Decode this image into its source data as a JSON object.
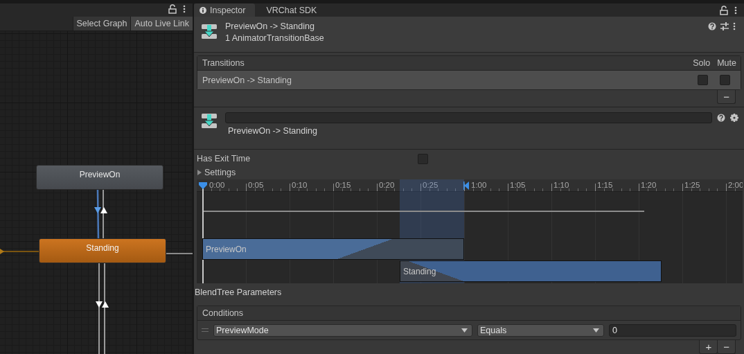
{
  "graph_panel": {
    "toolbar_buttons": [
      "Select Graph",
      "Auto Live Link"
    ],
    "nodes": [
      {
        "label": "PreviewOn",
        "kind": "state"
      },
      {
        "label": "Standing",
        "kind": "default"
      }
    ]
  },
  "inspector": {
    "tabs": [
      {
        "label": "Inspector",
        "selected": true
      },
      {
        "label": "VRChat SDK",
        "selected": false
      }
    ],
    "header": {
      "title": "PreviewOn -> Standing",
      "subtitle": "1 AnimatorTransitionBase"
    },
    "transitions": {
      "title": "Transitions",
      "columns": [
        "Solo",
        "Mute"
      ],
      "rows": [
        {
          "name": "PreviewOn -> Standing",
          "selected": true,
          "solo": false,
          "mute": false
        }
      ],
      "remove_button": "−"
    },
    "transition": {
      "label": "PreviewOn -> Standing"
    },
    "has_exit_time": {
      "label": "Has Exit Time",
      "checked": false
    },
    "settings": {
      "label": "Settings",
      "expanded": false
    },
    "timeline": {
      "ticks": [
        "0:00",
        "0:05",
        "0:10",
        "0:15",
        "0:20",
        "0:25",
        "1:00",
        "1:05",
        "1:10",
        "1:15",
        "1:20",
        "1:25",
        "2:00"
      ],
      "clips": [
        {
          "label": "PreviewOn"
        },
        {
          "label": "Standing"
        }
      ]
    },
    "blendtree_label": "BlendTree Parameters",
    "conditions": {
      "title": "Conditions",
      "rows": [
        {
          "parameter": "PreviewMode",
          "mode": "Equals",
          "value": "0"
        }
      ],
      "add_button": "+",
      "remove_button": "−"
    }
  }
}
